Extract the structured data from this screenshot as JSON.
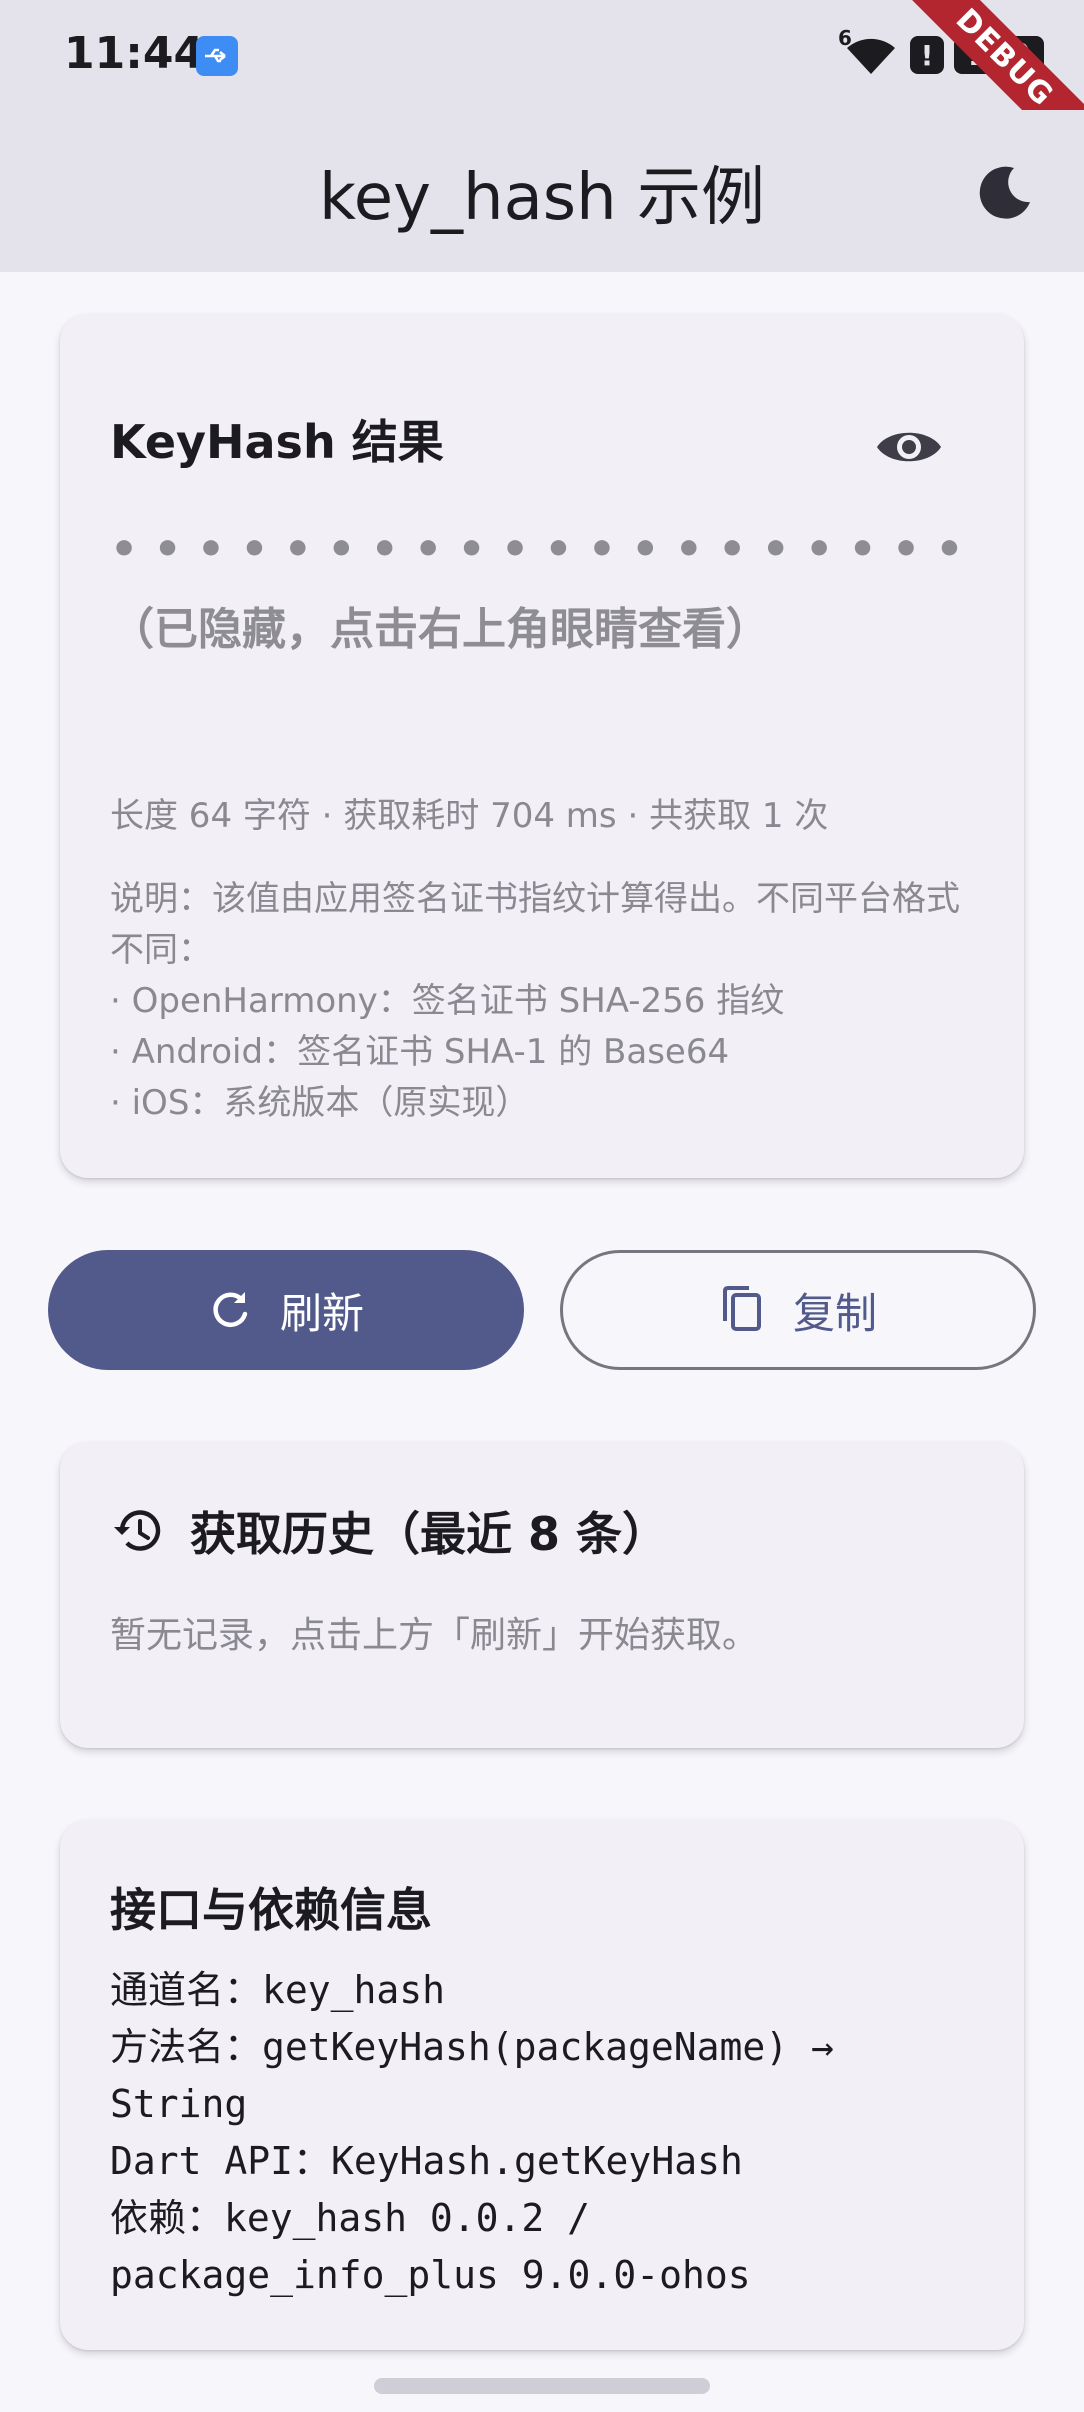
{
  "status": {
    "time": "11:44",
    "battery": "100",
    "alert": "!",
    "wifi_label": "6",
    "debug_banner": "DEBUG"
  },
  "appbar": {
    "title": "key_hash 示例",
    "theme_icon": "moon-icon"
  },
  "result_card": {
    "title": "KeyHash 结果",
    "toggle_icon": "eye-icon",
    "masked_value": "• • • •  • • • •  • • • •  • • • •  • • • • （已隐藏，点击右上角眼睛查看）",
    "meta": "长度 64 字符 · 获取耗时 704 ms · 共获取 1 次",
    "notes": [
      "说明：该值由应用签名证书指纹计算得出。不同平台格式不同：",
      "· OpenHarmony：签名证书 SHA-256 指纹",
      "· Android：签名证书 SHA-1 的 Base64",
      "· iOS：系统版本（原实现）"
    ]
  },
  "actions": {
    "refresh_label": "刷新",
    "refresh_icon": "refresh-icon",
    "copy_label": "复制",
    "copy_icon": "copy-icon",
    "accent": "#525a8c"
  },
  "history_card": {
    "title": "获取历史（最近 8 条）",
    "icon": "history-icon",
    "empty_text": "暂无记录，点击上方「刷新」开始获取。"
  },
  "info_card": {
    "title": "接口与依赖信息",
    "lines": [
      "通道名：key_hash",
      "方法名：getKeyHash(packageName) → String",
      "Dart API：KeyHash.getKeyHash",
      "依赖：key_hash 0.0.2 / package_info_plus 9.0.0-ohos"
    ]
  }
}
